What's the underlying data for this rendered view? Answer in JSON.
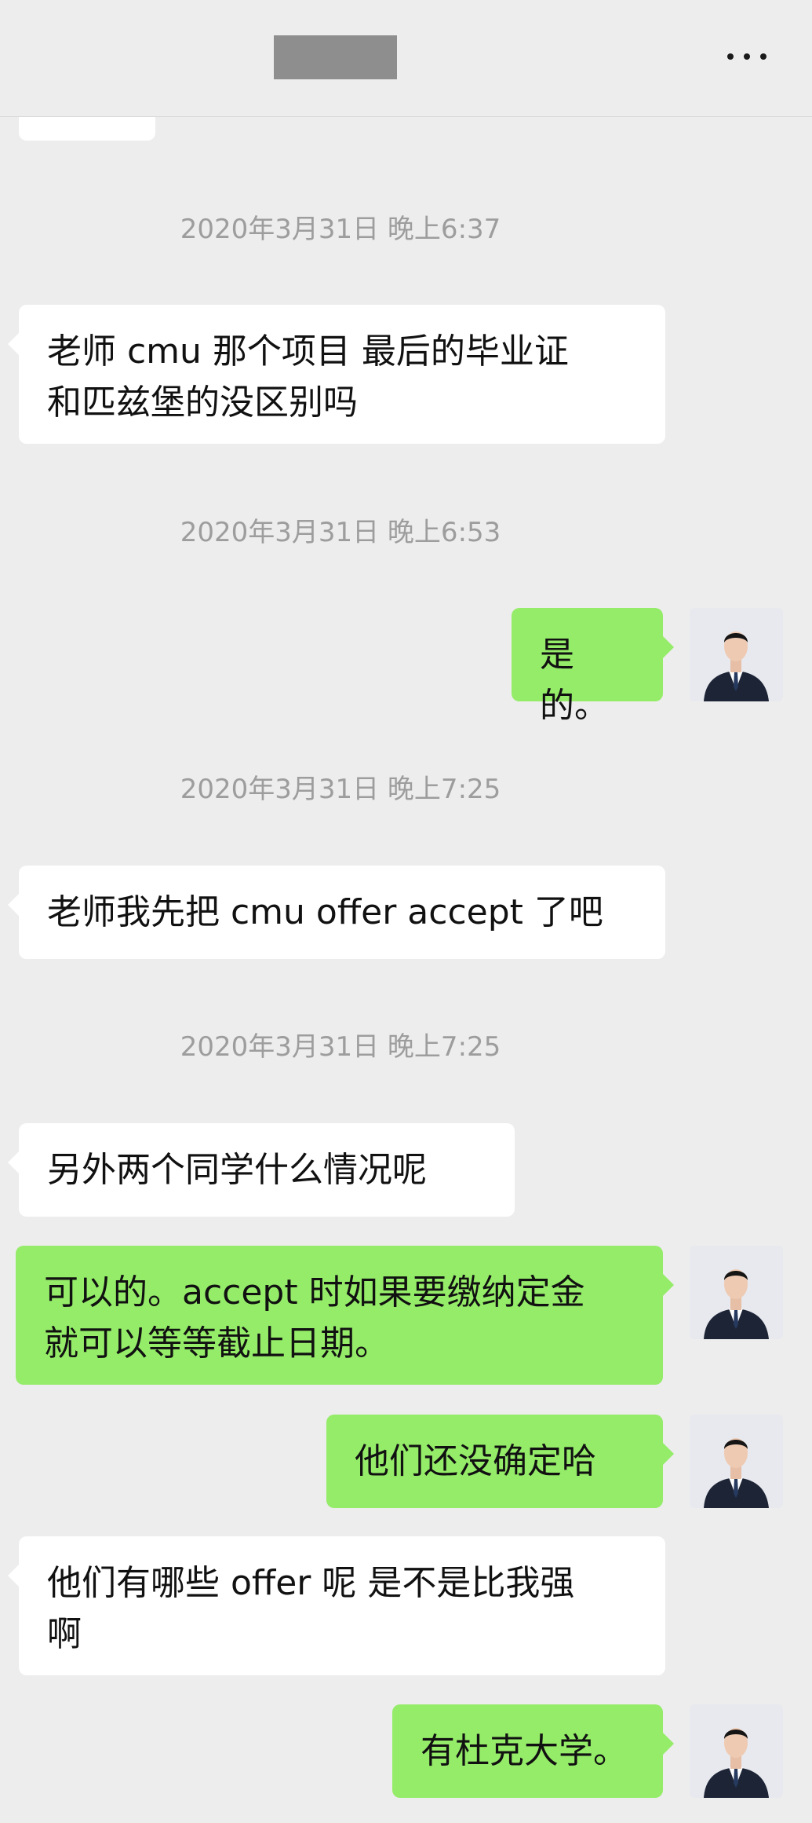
{
  "header": {
    "more_icon": "more-dots-icon"
  },
  "messages": [
    {
      "timestamp": "2020年3月31日 晚上6:37"
    },
    {
      "text": "老师 cmu 那个项目 最后的毕业证\n和匹兹堡的没区别吗"
    },
    {
      "timestamp": "2020年3月31日 晚上6:53"
    },
    {
      "text": "是的。"
    },
    {
      "timestamp": "2020年3月31日 晚上7:25"
    },
    {
      "text": "老师我先把 cmu offer accept 了吧"
    },
    {
      "timestamp": "2020年3月31日 晚上7:25"
    },
    {
      "text": "另外两个同学什么情况呢"
    },
    {
      "text": "可以的。accept 时如果要缴纳定金\n就可以等等截止日期。"
    },
    {
      "text": "他们还没确定哈"
    },
    {
      "text": "他们有哪些 offer 呢 是不是比我强\n啊"
    },
    {
      "text": "有杜克大学。"
    }
  ],
  "colors": {
    "incoming_bubble": "#ffffff",
    "outgoing_bubble": "#95ec69",
    "background": "#ededed"
  }
}
